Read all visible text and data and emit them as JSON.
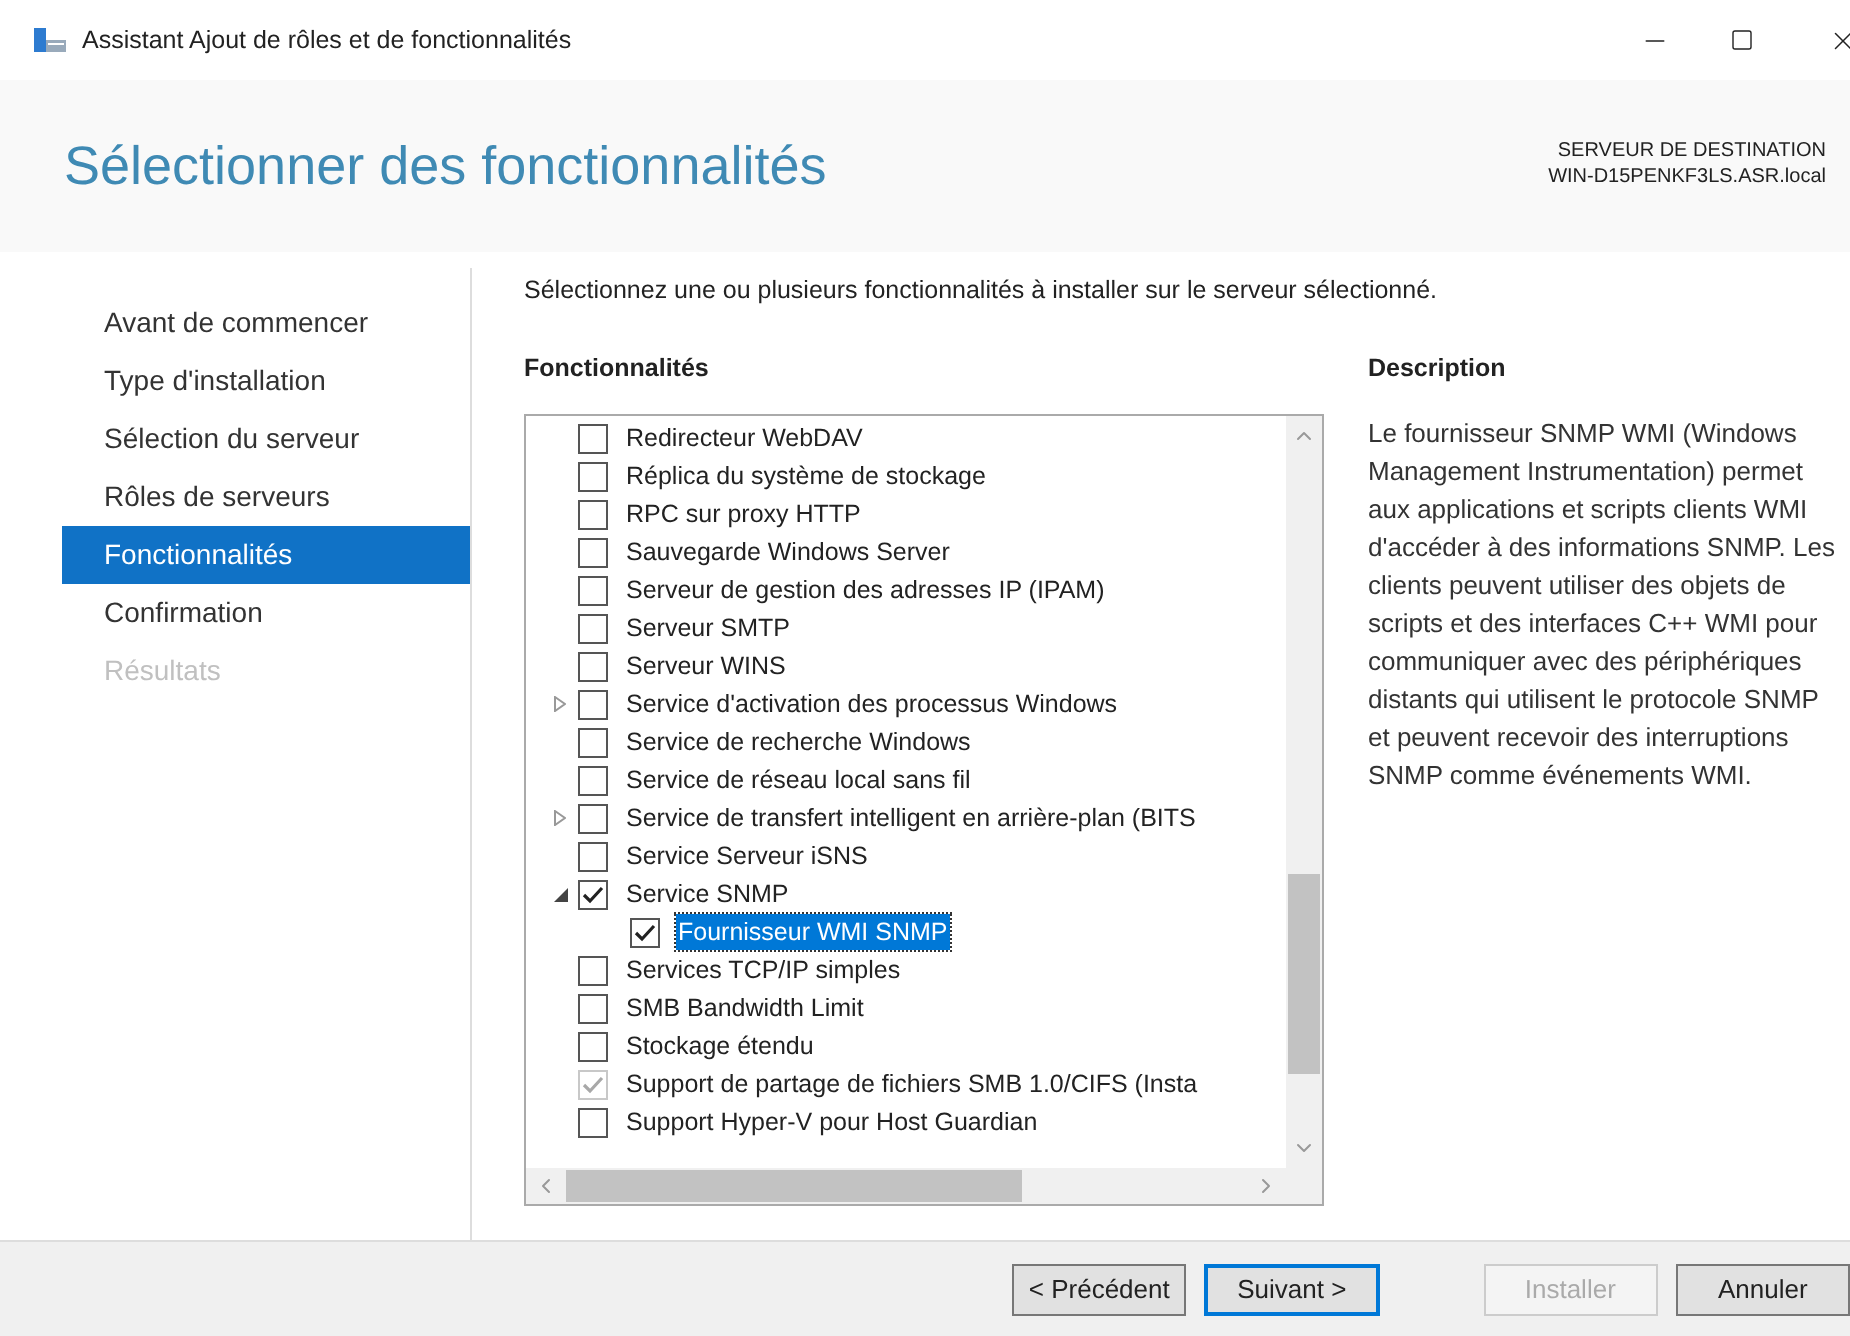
{
  "window": {
    "title": "Assistant Ajout de rôles et de fonctionnalités"
  },
  "header": {
    "title": "Sélectionner des fonctionnalités",
    "destination_label": "SERVEUR DE DESTINATION",
    "destination_server": "WIN-D15PENKF3LS.ASR.local"
  },
  "nav": [
    {
      "label": "Avant de commencer",
      "selected": false,
      "disabled": false
    },
    {
      "label": "Type d'installation",
      "selected": false,
      "disabled": false
    },
    {
      "label": "Sélection du serveur",
      "selected": false,
      "disabled": false
    },
    {
      "label": "Rôles de serveurs",
      "selected": false,
      "disabled": false
    },
    {
      "label": "Fonctionnalités",
      "selected": true,
      "disabled": false
    },
    {
      "label": "Confirmation",
      "selected": false,
      "disabled": false
    },
    {
      "label": "Résultats",
      "selected": false,
      "disabled": true
    }
  ],
  "instruction": "Sélectionnez une ou plusieurs fonctionnalités à installer sur le serveur sélectionné.",
  "features_heading": "Fonctionnalités",
  "features": [
    {
      "label": "Redirecteur WebDAV",
      "checked": false,
      "disabled": false,
      "selected": false,
      "kind": "leaf"
    },
    {
      "label": "Réplica du système de stockage",
      "checked": false,
      "disabled": false,
      "selected": false,
      "kind": "leaf"
    },
    {
      "label": "RPC sur proxy HTTP",
      "checked": false,
      "disabled": false,
      "selected": false,
      "kind": "leaf"
    },
    {
      "label": "Sauvegarde Windows Server",
      "checked": false,
      "disabled": false,
      "selected": false,
      "kind": "leaf"
    },
    {
      "label": "Serveur de gestion des adresses IP (IPAM)",
      "checked": false,
      "disabled": false,
      "selected": false,
      "kind": "leaf"
    },
    {
      "label": "Serveur SMTP",
      "checked": false,
      "disabled": false,
      "selected": false,
      "kind": "leaf"
    },
    {
      "label": "Serveur WINS",
      "checked": false,
      "disabled": false,
      "selected": false,
      "kind": "leaf"
    },
    {
      "label": "Service d'activation des processus Windows",
      "checked": false,
      "disabled": false,
      "selected": false,
      "kind": "collapsed"
    },
    {
      "label": "Service de recherche Windows",
      "checked": false,
      "disabled": false,
      "selected": false,
      "kind": "leaf"
    },
    {
      "label": "Service de réseau local sans fil",
      "checked": false,
      "disabled": false,
      "selected": false,
      "kind": "leaf"
    },
    {
      "label": "Service de transfert intelligent en arrière-plan (BITS",
      "checked": false,
      "disabled": false,
      "selected": false,
      "kind": "collapsed"
    },
    {
      "label": "Service Serveur iSNS",
      "checked": false,
      "disabled": false,
      "selected": false,
      "kind": "leaf"
    },
    {
      "label": "Service SNMP",
      "checked": true,
      "disabled": false,
      "selected": false,
      "kind": "expanded",
      "children": [
        {
          "label": "Fournisseur WMI SNMP",
          "checked": true,
          "disabled": false,
          "selected": true
        }
      ]
    },
    {
      "label": "Services TCP/IP simples",
      "checked": false,
      "disabled": false,
      "selected": false,
      "kind": "leaf"
    },
    {
      "label": "SMB Bandwidth Limit",
      "checked": false,
      "disabled": false,
      "selected": false,
      "kind": "leaf"
    },
    {
      "label": "Stockage étendu",
      "checked": false,
      "disabled": false,
      "selected": false,
      "kind": "leaf"
    },
    {
      "label": "Support de partage de fichiers SMB 1.0/CIFS (Insta",
      "checked": true,
      "disabled": true,
      "selected": false,
      "kind": "leaf"
    },
    {
      "label": "Support Hyper-V pour Host Guardian",
      "checked": false,
      "disabled": false,
      "selected": false,
      "kind": "leaf"
    }
  ],
  "description_heading": "Description",
  "description": "Le fournisseur SNMP WMI (Windows Management Instrumentation) permet aux applications et scripts clients WMI d'accéder à des informations SNMP. Les clients peuvent utiliser des objets de scripts et des interfaces C++ WMI pour communiquer avec des périphériques distants qui utilisent le protocole SNMP et peuvent recevoir des interruptions SNMP comme événements WMI.",
  "buttons": [
    {
      "label": "< Précédent",
      "disabled": false,
      "default": false
    },
    {
      "label": "Suivant >",
      "disabled": false,
      "default": true
    },
    {
      "label": "Installer",
      "disabled": true,
      "default": false
    },
    {
      "label": "Annuler",
      "disabled": false,
      "default": false
    }
  ]
}
